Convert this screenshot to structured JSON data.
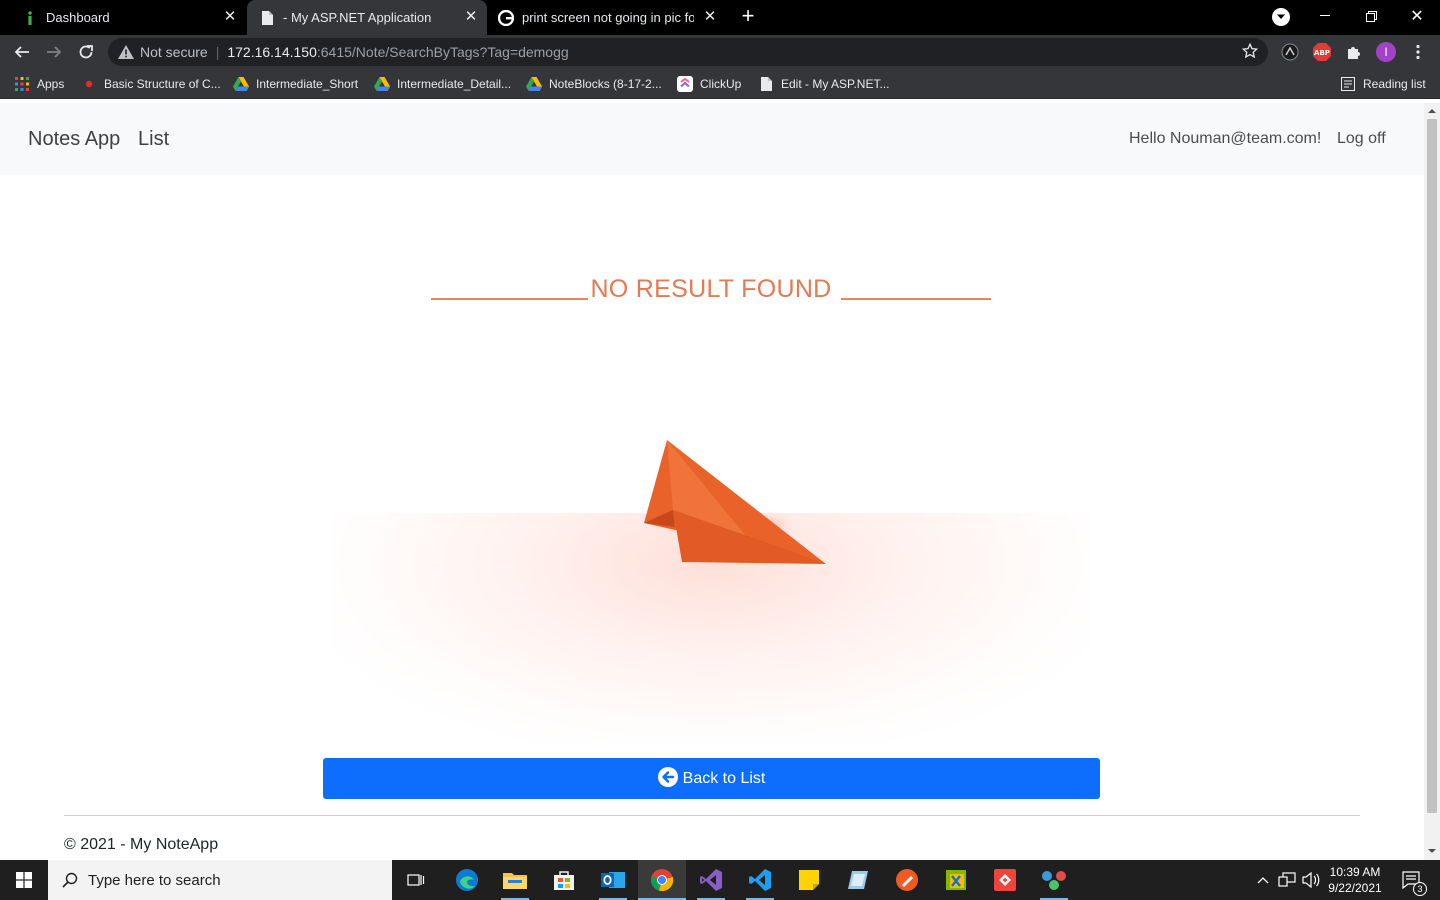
{
  "browser": {
    "tabs": [
      {
        "title": "Dashboard",
        "icon": "info-i-icon"
      },
      {
        "title": "- My ASP.NET Application",
        "icon": "page-icon"
      },
      {
        "title": "print screen not going in pic fold",
        "icon": "google-icon"
      }
    ],
    "address": {
      "security": "Not secure",
      "host": "172.16.14.150",
      "path": ":6415/Note/SearchByTags?Tag=demogg"
    },
    "profile_initial": "I",
    "abp_label": "ABP",
    "bookmarks": [
      {
        "label": "Apps",
        "icon": "apps-grid-icon"
      },
      {
        "label": "Basic Structure of C...",
        "icon": "red-dot-icon"
      },
      {
        "label": "Intermediate_Short",
        "icon": "google-drive-icon"
      },
      {
        "label": "Intermediate_Detail...",
        "icon": "google-drive-icon"
      },
      {
        "label": "NoteBlocks (8-17-2...",
        "icon": "google-drive-icon"
      },
      {
        "label": "ClickUp",
        "icon": "clickup-icon"
      },
      {
        "label": "Edit - My ASP.NET...",
        "icon": "page-icon"
      }
    ],
    "reading_list": "Reading list"
  },
  "app": {
    "brand": "Notes App",
    "nav_list": "List",
    "greeting": "Hello Nouman@team.com!",
    "logoff": "Log off",
    "no_result": "NO RESULT FOUND",
    "back_button": "Back to List",
    "footer": "© 2021 - My NoteApp"
  },
  "taskbar": {
    "search_placeholder": "Type here to search",
    "time": "10:39 AM",
    "date": "9/22/2021",
    "notification_count": "3"
  },
  "colors": {
    "accent_orange": "#e37a52",
    "button_blue": "#0d6efd",
    "plane_orange": "#e8622a"
  }
}
